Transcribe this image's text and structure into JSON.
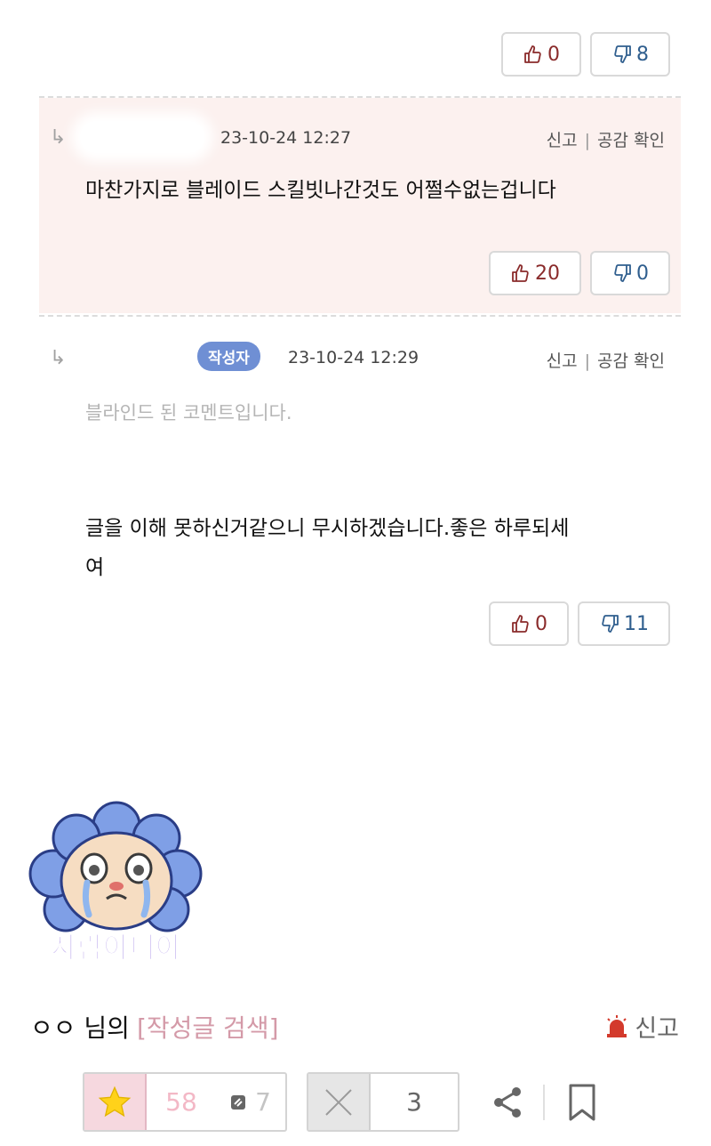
{
  "top_votes": {
    "up": "0",
    "down": "8"
  },
  "comment1": {
    "timestamp": "23-10-24 12:27",
    "report": "신고",
    "empathy": "공감 확인",
    "text": "마찬가지로 블레이드 스킬빗나간것도 어쩔수없는겁니다",
    "up": "20",
    "down": "0"
  },
  "comment2": {
    "badge": "작성자",
    "timestamp": "23-10-24 12:29",
    "report": "신고",
    "empathy": "공감 확인",
    "blinded_text": "블라인드 된 코멘트입니다.",
    "text_line1": "글을 이해 못하신거같으니 무시하겠습니다.좋은 하루되세",
    "text_line2": "여",
    "up": "0",
    "down": "11"
  },
  "sticker": {
    "caption": "사람아니야"
  },
  "footer": {
    "author_name": "ㅇㅇ 님의",
    "search_link": "[작성글 검색]",
    "report": "신고",
    "recommend_count": "58",
    "fixed_recommend_count": "7",
    "nonrecommend_count": "3"
  },
  "icons": [
    "reply-arrow-icon",
    "thumbs-up-icon",
    "thumbs-down-icon",
    "siren-icon",
    "star-icon",
    "close-x-icon",
    "share-icon",
    "bookmark-icon"
  ],
  "colors": {
    "upvote": "#8a2b2b",
    "downvote": "#2f5e8e",
    "highlight_bg": "#fcf1ef",
    "badge": "#6f8fd4",
    "star_bg": "#f6d8df",
    "siren": "#d33a2c"
  }
}
